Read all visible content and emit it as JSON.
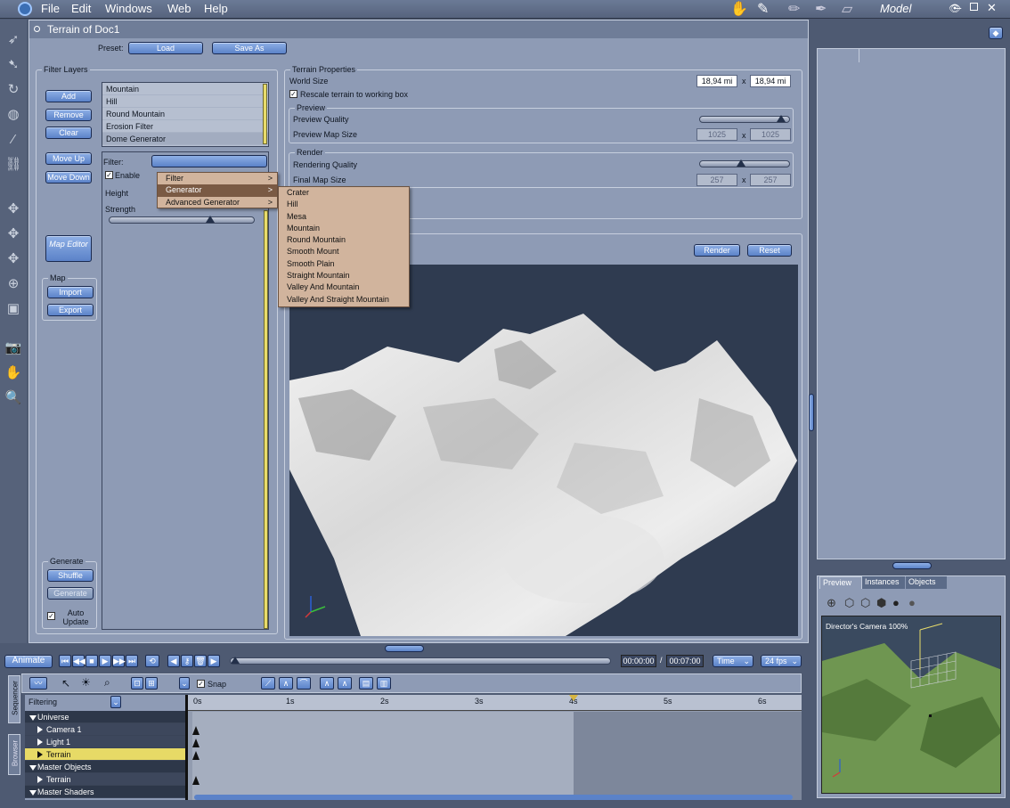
{
  "menubar": {
    "items": [
      "File",
      "Edit",
      "Windows",
      "Web",
      "Help"
    ],
    "mode": "Model",
    "window_controls": [
      "eye-icon",
      "minimize-icon",
      "maximize-icon",
      "close-icon"
    ]
  },
  "window": {
    "title": "Terrain of Doc1",
    "preset_label": "Preset:",
    "load": "Load",
    "save_as": "Save As"
  },
  "filter_layers": {
    "title": "Filter Layers",
    "buttons": {
      "add": "Add",
      "remove": "Remove",
      "clear": "Clear",
      "move_up": "Move Up",
      "move_down": "Move Down",
      "map_editor": "Map Editor"
    },
    "layers": [
      "Mountain",
      "Hill",
      "Round Mountain",
      "Erosion Filter",
      "Dome Generator"
    ],
    "filter_label": "Filter:",
    "enable_label": "Enable",
    "height_label": "Height",
    "strength_label": "Strength",
    "map_title": "Map",
    "import": "Import",
    "export": "Export",
    "generate_title": "Generate",
    "shuffle": "Shuffle",
    "generate": "Generate",
    "auto_update": "Auto Update"
  },
  "terrain_props": {
    "title": "Terrain Properties",
    "world_size_label": "World Size",
    "world_size_x": "18,94 mi",
    "world_size_sep": "x",
    "world_size_y": "18,94 mi",
    "rescale_label": "Rescale terrain to working box",
    "preview_title": "Preview",
    "preview_quality": "Preview Quality",
    "preview_map_size": "Preview Map Size",
    "preview_w": "1025",
    "preview_h": "1025",
    "render_title": "Render",
    "rendering_quality": "Rendering Quality",
    "final_map_size": "Final Map Size",
    "final_w": "257",
    "final_h": "257",
    "render": "Render",
    "reset": "Reset",
    "preview_quality_level": 0.95,
    "rendering_quality_level": 0.45
  },
  "context_menu": {
    "items": [
      "Filter",
      "Generator",
      "Advanced Generator"
    ],
    "selected": "Generator",
    "arrow": ">",
    "submenu": [
      "Crater",
      "Hill",
      "Mesa",
      "Mountain",
      "Round Mountain",
      "Smooth Mount",
      "Smooth Plain",
      "Straight Mountain",
      "Valley And Mountain",
      "Valley And Straight Mountain"
    ]
  },
  "timeline": {
    "animate": "Animate",
    "time_current": "00:00:00",
    "time_sep": "/",
    "time_total": "00:07:00",
    "time_mode": "Time",
    "fps": "24 fps",
    "snap": "Snap",
    "filtering": "Filtering",
    "ruler": [
      "0s",
      "1s",
      "2s",
      "3s",
      "4s",
      "5s",
      "6s"
    ],
    "side_tabs": [
      "Sequencer",
      "Browser"
    ],
    "tracks": [
      {
        "name": "Universe",
        "expanded": true,
        "level": 0
      },
      {
        "name": "Camera 1",
        "level": 1
      },
      {
        "name": "Light 1",
        "level": 1
      },
      {
        "name": "Terrain",
        "level": 1,
        "selected": true
      },
      {
        "name": "Master Objects",
        "expanded": true,
        "level": 0
      },
      {
        "name": "Terrain",
        "level": 1
      },
      {
        "name": "Master Shaders",
        "expanded": true,
        "level": 0
      }
    ]
  },
  "right_panel": {
    "tabs": [
      "Preview",
      "Instances",
      "Objects"
    ],
    "camera_label": "Director's Camera 100%"
  }
}
